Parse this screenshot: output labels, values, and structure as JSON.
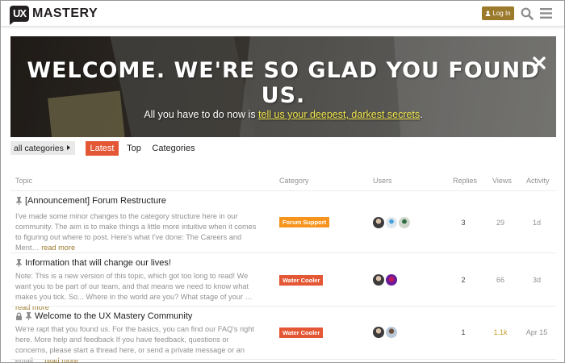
{
  "header": {
    "logo_badge": "UX",
    "logo_text": "MASTERY",
    "login_label": "Log In"
  },
  "banner": {
    "title": "WELCOME. WE'RE SO GLAD YOU FOUND US.",
    "subtitle_prefix": "All you have to do now is ",
    "subtitle_link1": "tell us your deepest",
    "subtitle_sep": ", ",
    "subtitle_link2": "darkest secrets",
    "subtitle_suffix": "."
  },
  "nav": {
    "category_dropdown": "all categories",
    "tabs": [
      {
        "label": "Latest",
        "active": true
      },
      {
        "label": "Top",
        "active": false
      },
      {
        "label": "Categories",
        "active": false
      }
    ]
  },
  "table": {
    "headers": {
      "topic": "Topic",
      "category": "Category",
      "users": "Users",
      "replies": "Replies",
      "views": "Views",
      "activity": "Activity"
    },
    "rows": [
      {
        "title": "[Announcement] Forum Restructure",
        "pinned": true,
        "locked": false,
        "excerpt": "I've made some minor changes to the category structure here in our community. The aim is to make things a little more intuitive when it comes to figuring out where to post. Here's what I've done: The Careers and Ment…",
        "read_more": "read more",
        "category": "Forum Support",
        "category_color": "#f7941d",
        "replies": "3",
        "views": "29",
        "activity": "1d"
      },
      {
        "title": "Information that will change our lives!",
        "pinned": true,
        "locked": false,
        "excerpt": "Note: This is a new version of this topic, which got too long to read! We want you to be part of our team, and that means we need to know what makes you tick. So... Where in the world are you? What stage of your …",
        "read_more": "read more",
        "category": "Water Cooler",
        "category_color": "#e45735",
        "replies": "2",
        "views": "66",
        "activity": "3d"
      },
      {
        "title": "Welcome to the UX Mastery Community",
        "pinned": true,
        "locked": true,
        "excerpt": "We're rapt that you found us. For the basics, you can find our FAQ's right here. More help and feedback If you have feedback, questions or concerns, please start a thread here, or send a private message or an email.…",
        "read_more": "read more",
        "category": "Water Cooler",
        "category_color": "#e45735",
        "replies": "1",
        "views": "1.1k",
        "activity": "Apr 15"
      }
    ]
  },
  "colors": {
    "brand_gold": "#9c7a2c",
    "latest_tab": "#e45735",
    "highlight_link": "#f1e64c"
  }
}
